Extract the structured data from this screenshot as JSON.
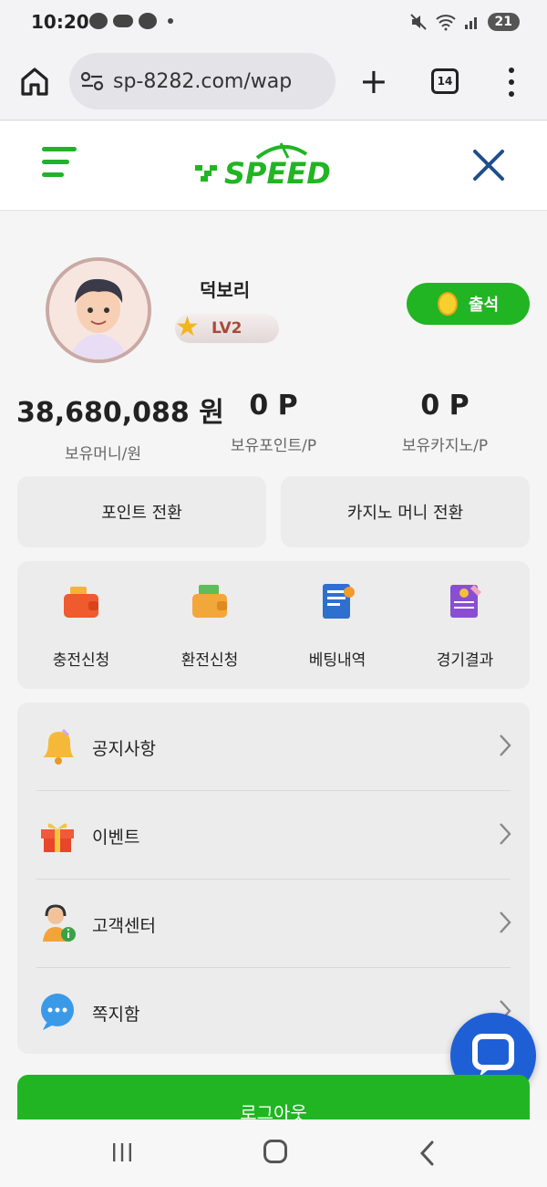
{
  "status_bar": {
    "time": "10:20",
    "battery": "21",
    "icons": [
      "talk-icon",
      "cloud-icon",
      "message-icon",
      "mute-icon",
      "wifi-icon",
      "signal-icon"
    ]
  },
  "browser": {
    "url": "sp-8282.com/wap",
    "tab_count": "14"
  },
  "site": {
    "logo_text": "SPEED",
    "brand_color": "#21b523"
  },
  "profile": {
    "nickname": "덕보리",
    "level": "LV2",
    "attend_label": "출석"
  },
  "balances": {
    "money_value": "38,680,088 원",
    "money_label": "보유머니/원",
    "point_value": "0 P",
    "point_label": "보유포인트/P",
    "casino_value": "0 P",
    "casino_label": "보유카지노/P"
  },
  "conversion": {
    "point_btn": "포인트 전환",
    "casino_btn": "카지노 머니 전환"
  },
  "quick_menu": {
    "deposit": "충전신청",
    "withdraw": "환전신청",
    "bet_history": "베팅내역",
    "results": "경기결과"
  },
  "menu_list": {
    "notice": "공지사항",
    "event": "이벤트",
    "support": "고객센터",
    "inbox": "쪽지함"
  },
  "logout_label": "로그아웃"
}
